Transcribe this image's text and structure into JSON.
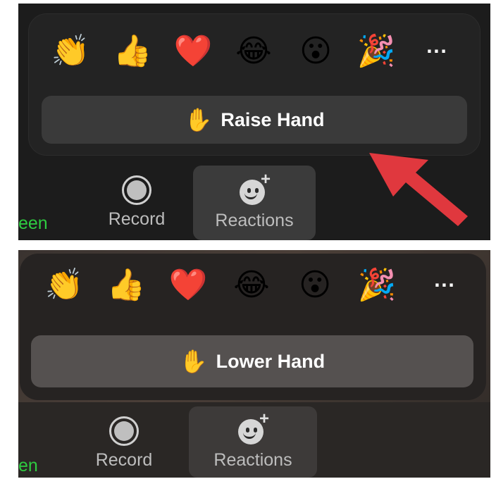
{
  "top_panel": {
    "emojis": [
      {
        "icon": "clapping-hands-icon",
        "glyph": "👏"
      },
      {
        "icon": "thumbs-up-icon",
        "glyph": "👍"
      },
      {
        "icon": "red-heart-icon",
        "glyph": "❤️"
      },
      {
        "icon": "tears-of-joy-icon",
        "glyph": "😂"
      },
      {
        "icon": "surprised-face-icon",
        "glyph": "😮"
      },
      {
        "icon": "party-popper-icon",
        "glyph": "🎉"
      }
    ],
    "more_label": "···",
    "hand_button": {
      "glyph": "✋",
      "label": "Raise Hand"
    },
    "toolbar": {
      "partial_label": "een",
      "record_label": "Record",
      "reactions_label": "Reactions",
      "reactions_plus": "+"
    },
    "arrow_color": "#e0383e"
  },
  "bottom_panel": {
    "emojis": [
      {
        "icon": "clapping-hands-icon",
        "glyph": "👏"
      },
      {
        "icon": "thumbs-up-icon",
        "glyph": "👍"
      },
      {
        "icon": "red-heart-icon",
        "glyph": "❤️"
      },
      {
        "icon": "tears-of-joy-icon",
        "glyph": "😂"
      },
      {
        "icon": "surprised-face-icon",
        "glyph": "😮"
      },
      {
        "icon": "party-popper-icon",
        "glyph": "🎉"
      }
    ],
    "more_label": "···",
    "hand_button": {
      "glyph": "✋",
      "label": "Lower Hand"
    },
    "toolbar": {
      "partial_label": "en",
      "record_label": "Record",
      "reactions_label": "Reactions",
      "reactions_plus": "+"
    }
  }
}
